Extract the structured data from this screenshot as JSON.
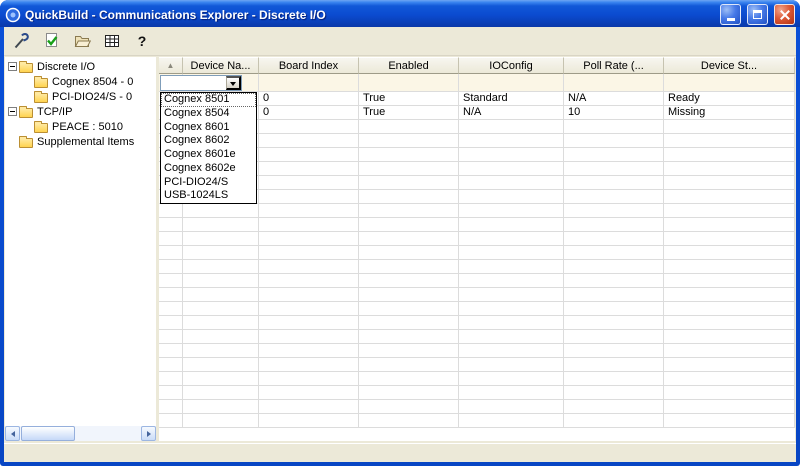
{
  "window": {
    "title": "QuickBuild - Communications Explorer - Discrete I/O",
    "controls": [
      "minimize",
      "maximize",
      "close"
    ]
  },
  "colors": {
    "frame": "#0a50d8",
    "titlebar_top": "#3c86f0",
    "titlebar_bottom": "#0a3cb0",
    "panel": "#ece9d8",
    "header_bg": "#ece9d8",
    "close_button": "#dd5a37",
    "gridline": "#dcdcdc",
    "edit_row_bg": "#fbf6e6",
    "folder_yellow": "#ffd34f",
    "scrollbar_blue": "#c6d8f8"
  },
  "toolbar": {
    "buttons": [
      {
        "icon": "probe-tool-icon"
      },
      {
        "icon": "validate-check-icon"
      },
      {
        "icon": "open-folder-icon"
      },
      {
        "icon": "device-grid-icon"
      },
      {
        "icon": "help-icon"
      }
    ]
  },
  "tree": {
    "items": [
      {
        "label": "Discrete I/O",
        "level": 0,
        "expanded": true
      },
      {
        "label": "Cognex 8504 - 0",
        "level": 1
      },
      {
        "label": "PCI-DIO24/S - 0",
        "level": 1
      },
      {
        "label": "TCP/IP",
        "level": 0,
        "expanded": true
      },
      {
        "label": "PEACE : 5010",
        "level": 1
      },
      {
        "label": "Supplemental Items",
        "level": 0
      }
    ]
  },
  "grid": {
    "sort_glyph": "▲",
    "columns": [
      "Device Na...",
      "Board Index",
      "Enabled",
      "IOConfig",
      "Poll Rate (...",
      "Device St..."
    ],
    "rows": [
      [
        "",
        "0",
        "True",
        "Standard",
        "N/A",
        "Ready"
      ],
      [
        "",
        "0",
        "True",
        "N/A",
        "10",
        "Missing"
      ]
    ],
    "visible_empty_rows": 22
  },
  "device_dropdown": {
    "value": "",
    "options": [
      "Cognex 8501",
      "Cognex 8504",
      "Cognex 8601",
      "Cognex 8602",
      "Cognex 8601e",
      "Cognex 8602e",
      "PCI-DIO24/S",
      "USB-1024LS"
    ]
  }
}
